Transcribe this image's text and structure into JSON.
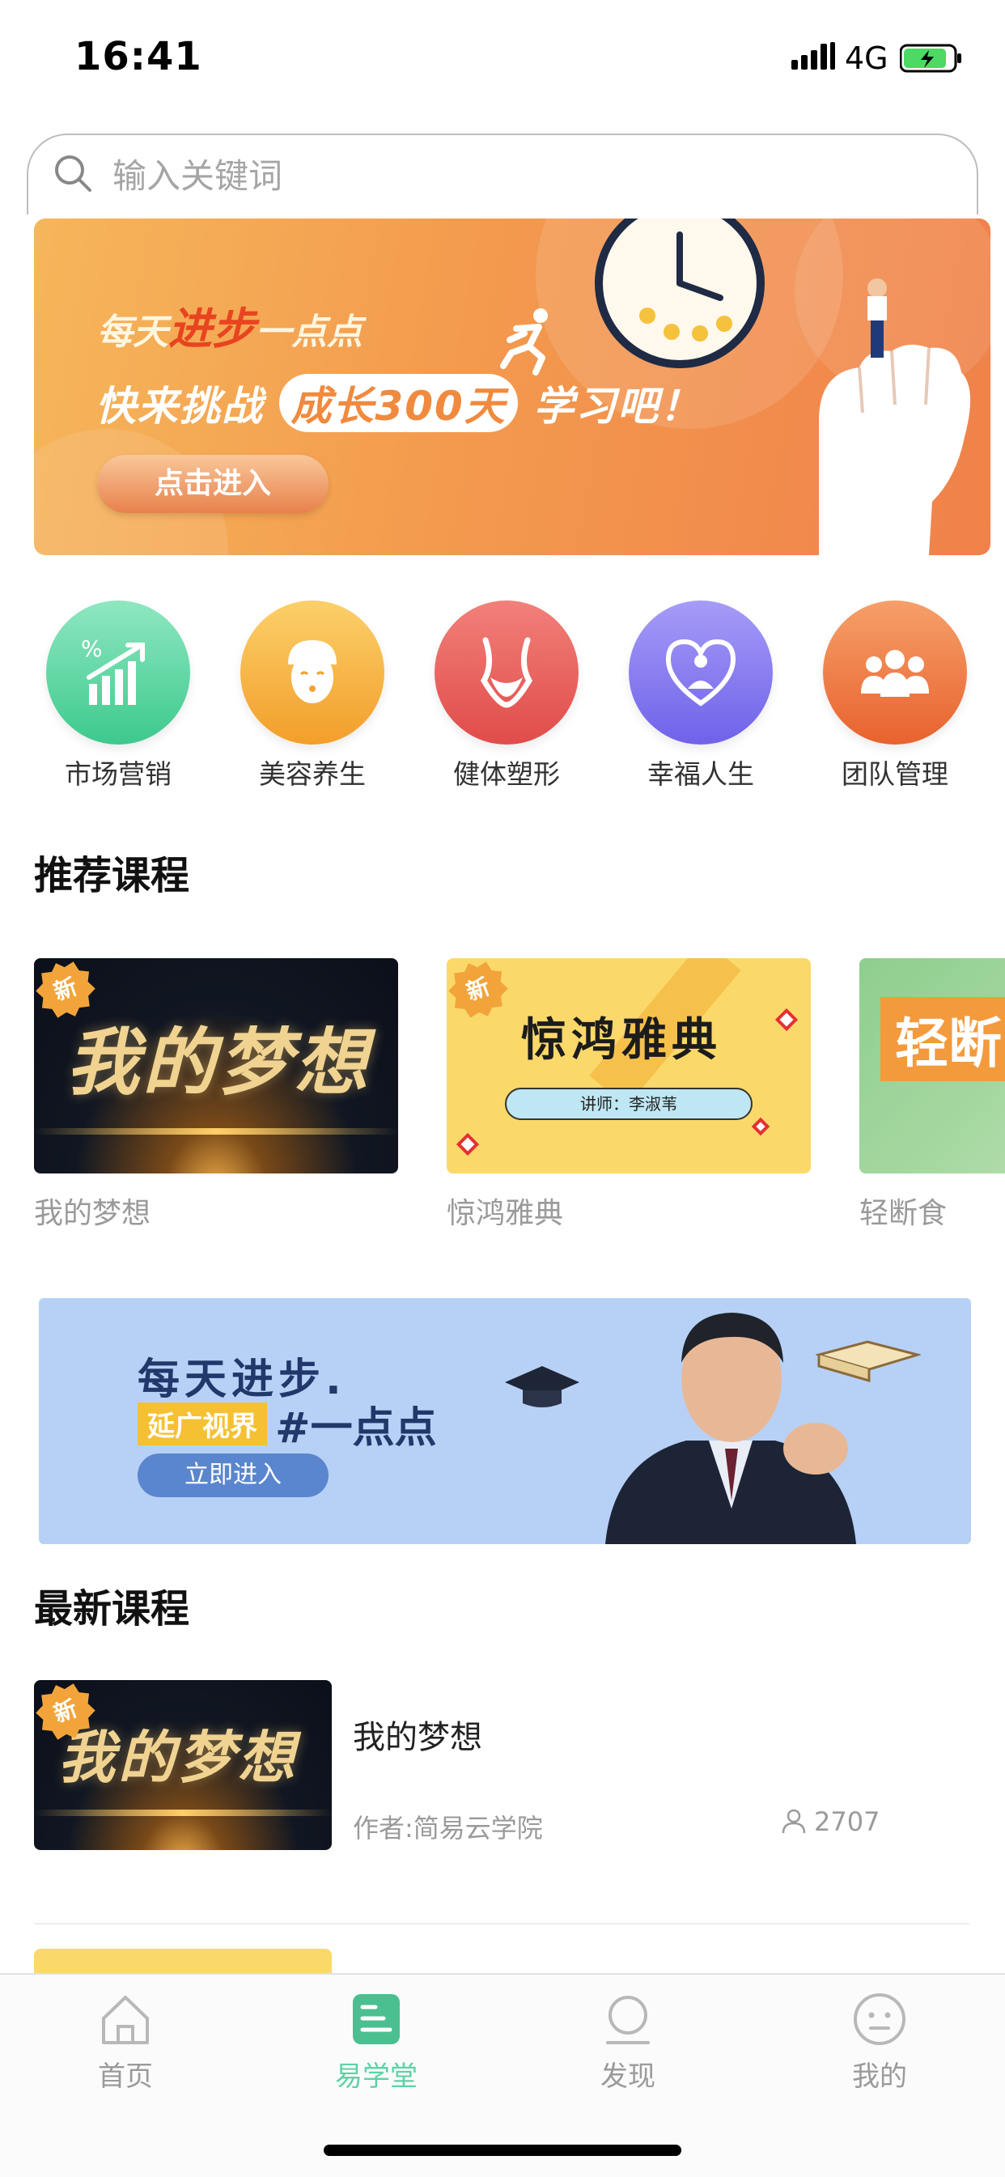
{
  "status_bar": {
    "time": "16:41",
    "network": "4G"
  },
  "search": {
    "placeholder": "输入关键词"
  },
  "banner": {
    "line1_prefix": "每天",
    "line1_highlight": "进步",
    "line1_suffix": "一点点",
    "line2_prefix": "快来挑战",
    "line2_pill": "成长300天",
    "line2_suffix": "学习吧！",
    "button": "点击进入"
  },
  "categories": [
    {
      "label": "市场营销",
      "color": "#5ed6a4",
      "icon": "chart-growth-icon"
    },
    {
      "label": "美容养生",
      "color": "#f6b43e",
      "icon": "face-mask-icon"
    },
    {
      "label": "健体塑形",
      "color": "#ea5f5a",
      "icon": "body-shape-icon"
    },
    {
      "label": "幸福人生",
      "color": "#8a7cf2",
      "icon": "heart-meditation-icon"
    },
    {
      "label": "团队管理",
      "color": "#f07a44",
      "icon": "team-icon"
    }
  ],
  "recommended": {
    "title": "推荐课程",
    "courses": [
      {
        "name": "我的梦想",
        "badge": "新",
        "thumb_text": "我的梦想"
      },
      {
        "name": "惊鸿雅典",
        "badge": "新",
        "thumb_text": "惊鸿雅典",
        "thumb_sub": "讲师：李淑苇"
      },
      {
        "name": "轻断食",
        "thumb_text": "轻断"
      }
    ]
  },
  "promo": {
    "line1": "每天进步.",
    "tag": "延广视界",
    "big": "#一点点",
    "button": "立即进入"
  },
  "latest": {
    "title": "最新课程",
    "items": [
      {
        "title": "我的梦想",
        "author": "作者:简易云学院",
        "views": "2707",
        "badge": "新",
        "thumb_text": "我的梦想"
      }
    ]
  },
  "tabbar": {
    "items": [
      {
        "label": "首页",
        "icon": "home-icon"
      },
      {
        "label": "易学堂",
        "icon": "course-icon",
        "active": true
      },
      {
        "label": "发现",
        "icon": "discover-icon"
      },
      {
        "label": "我的",
        "icon": "profile-icon"
      }
    ]
  },
  "colors": {
    "accent": "#5fd2a6",
    "banner_orange": "#f39a4e",
    "promo_blue": "#b7d1f6"
  }
}
